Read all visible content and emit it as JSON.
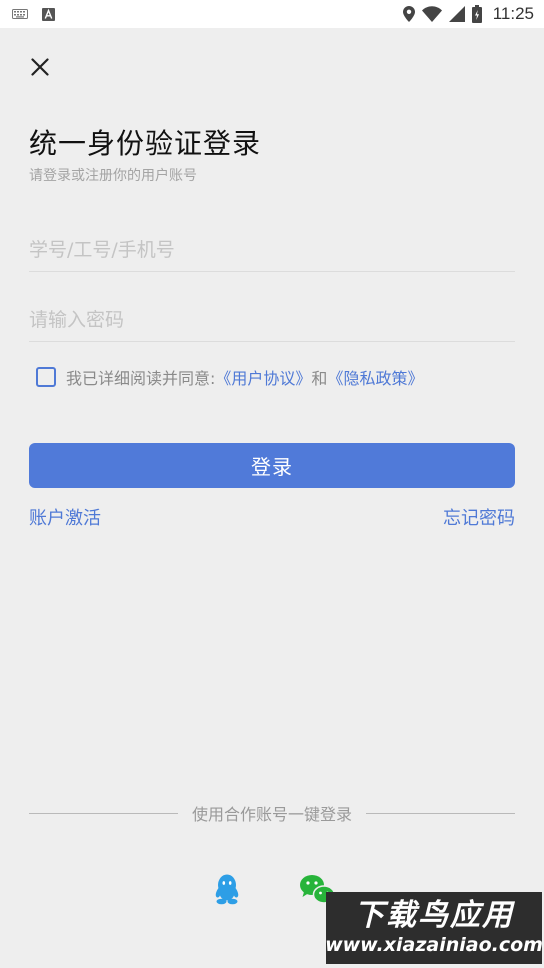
{
  "status_bar": {
    "time": "11:25",
    "left_icons": [
      "keyboard-icon",
      "a-app-icon"
    ],
    "right_icons": [
      "location-icon",
      "wifi-icon",
      "signal-icon",
      "battery-icon"
    ]
  },
  "header": {
    "close_icon": "close-icon",
    "title": "统一身份验证登录",
    "subtitle": "请登录或注册你的用户账号"
  },
  "form": {
    "account_placeholder": "学号/工号/手机号",
    "account_value": "",
    "password_placeholder": "请输入密码",
    "password_value": "",
    "agreement": {
      "checked": false,
      "prefix": "我已详细阅读并同意:",
      "user_agreement": "《用户协议》",
      "conjunction": "和",
      "privacy_policy": "《隐私政策》"
    },
    "login_label": "登录",
    "activate_label": "账户激活",
    "forgot_label": "忘记密码"
  },
  "third_party": {
    "divider_text": "使用合作账号一键登录",
    "providers": [
      "qq-icon",
      "wechat-icon"
    ]
  },
  "watermark": {
    "cn": "下载鸟应用",
    "url": "www.xiazainiao.com"
  },
  "colors": {
    "accent": "#507ad9",
    "background": "#eeeeee",
    "qq": "#2d9ee6",
    "wechat": "#27b43a"
  }
}
